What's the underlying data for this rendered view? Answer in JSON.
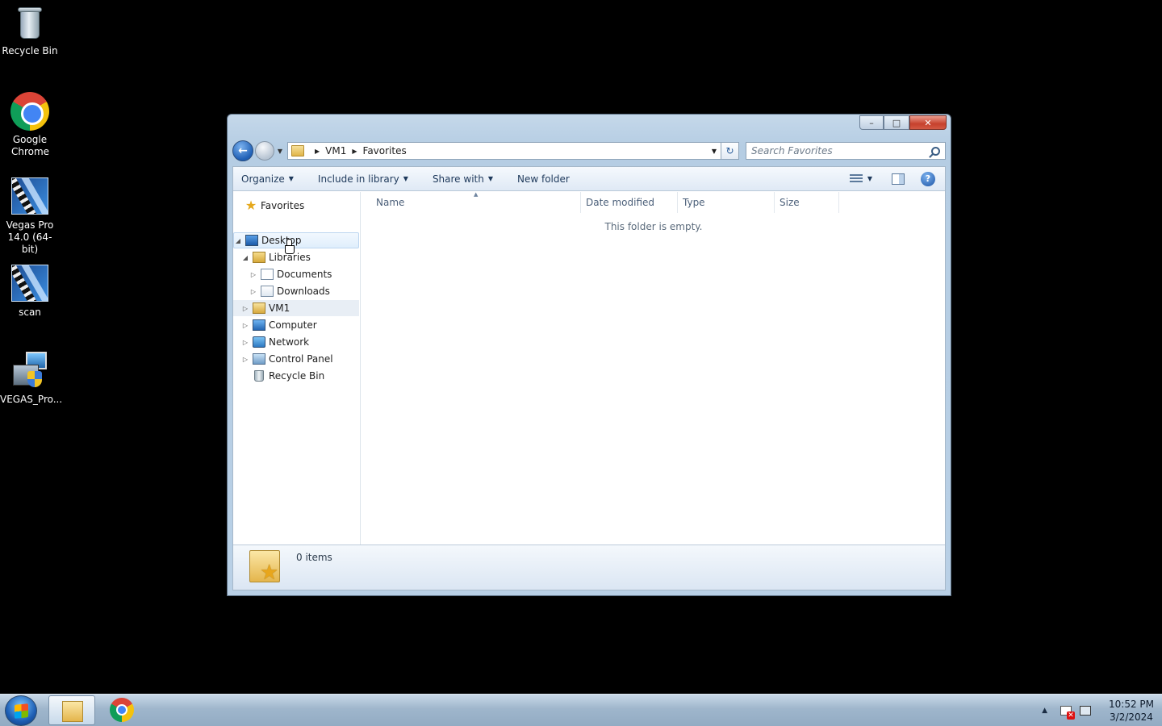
{
  "desktop": {
    "icons": [
      {
        "label": "Recycle Bin"
      },
      {
        "label": "Google Chrome"
      },
      {
        "label": "Vegas Pro 14.0 (64-bit)"
      },
      {
        "label": "scan"
      },
      {
        "label": "VEGAS_Pro..."
      }
    ]
  },
  "window": {
    "address": {
      "crumbs": [
        "VM1",
        "Favorites"
      ]
    },
    "search": {
      "placeholder": "Search Favorites"
    },
    "toolbar": {
      "organize": "Organize",
      "include_in_library": "Include in library",
      "share_with": "Share with",
      "new_folder": "New folder"
    },
    "nav_pane": {
      "favorites": "Favorites",
      "items": [
        {
          "label": "Desktop",
          "selected": true
        },
        {
          "label": "Libraries"
        },
        {
          "label": "Documents"
        },
        {
          "label": "Downloads"
        },
        {
          "label": "VM1"
        },
        {
          "label": "Computer"
        },
        {
          "label": "Network"
        },
        {
          "label": "Control Panel"
        },
        {
          "label": "Recycle Bin"
        }
      ]
    },
    "columns": [
      "Name",
      "Date modified",
      "Type",
      "Size"
    ],
    "empty_message": "This folder is empty.",
    "details": {
      "item_count": "0 items"
    }
  },
  "taskbar": {
    "clock": {
      "time": "10:52 PM",
      "date": "3/2/2024"
    }
  }
}
